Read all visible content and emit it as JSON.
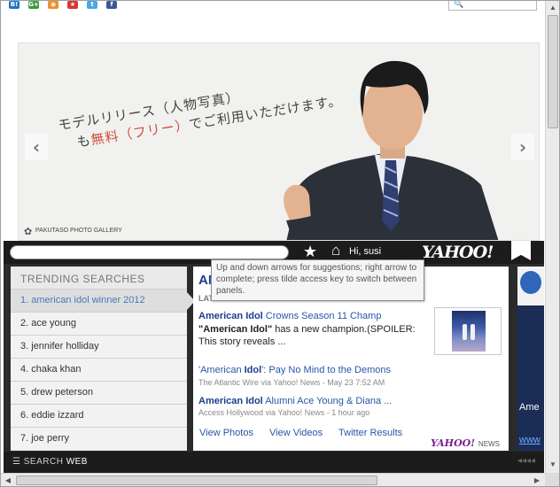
{
  "share_bar": {
    "icons": [
      {
        "name": "hatena-bookmark-icon",
        "glyph": "B!",
        "color": "#1a76c8"
      },
      {
        "name": "googleplus-icon",
        "glyph": "G+",
        "color": "#3f9a3a"
      },
      {
        "name": "rss-icon",
        "glyph": "◉",
        "color": "#f08e23"
      },
      {
        "name": "livedoor-icon",
        "glyph": "★",
        "color": "#d33"
      },
      {
        "name": "twitter-icon",
        "glyph": "t",
        "color": "#4aa7e0"
      },
      {
        "name": "facebook-icon",
        "glyph": "f",
        "color": "#3b5998"
      }
    ],
    "search_icon": "🔍"
  },
  "hero": {
    "line1": "モデルリリース（人物写真）",
    "line2_prefix": "も",
    "line2_highlight": "無料（フリー）",
    "line2_suffix": "でご利用いただけます。",
    "gallery_label": "PAKUTASO PHOTO GALLERY",
    "prev_arrow": "‹",
    "next_arrow": "›"
  },
  "toolbar": {
    "search_value": "",
    "greeting": "Hi, susi",
    "logo": "YAHOO!"
  },
  "tooltip": {
    "text": "Up and down arrows for suggestions; right arrow to complete; press tilde access key to switch between panels."
  },
  "trending": {
    "heading": "TRENDING SEARCHES",
    "items": [
      "1. american idol winner 2012",
      "2. ace young",
      "3. jennifer holliday",
      "4. chaka khan",
      "5. drew peterson",
      "6. eddie izzard",
      "7. joe perry"
    ]
  },
  "news": {
    "title": "AM",
    "latest_label": "LAT",
    "story1": {
      "head_bold": "American Idol",
      "head_rest": " Crowns Season 11 Champ",
      "body_bold": "\"American Idol\"",
      "body_rest": " has a new champion.(SPOILER: This story reveals ..."
    },
    "story2": {
      "head_prefix": "'American ",
      "head_bold": "Idol",
      "head_rest": "': Pay No Mind to the Demons",
      "source": "The Atlantic Wire via Yahoo! News - May 23 7:52 AM"
    },
    "story3": {
      "head_bold": "American Idol",
      "head_rest": " Alumni Ace Young & Diana ...",
      "source": "Access Hollywood via Yahoo! News - 1 hour ago"
    },
    "links": [
      "View Photos",
      "View Videos",
      "Twitter Results"
    ],
    "brand": "YAHOO!",
    "brand_suffix": "NEWS"
  },
  "side_card": {
    "text": "Ame",
    "link": "www"
  },
  "bottom_bar": {
    "label_prefix": "SEARCH ",
    "label_bold": "WEB",
    "dots": "◂◂◂◂"
  }
}
